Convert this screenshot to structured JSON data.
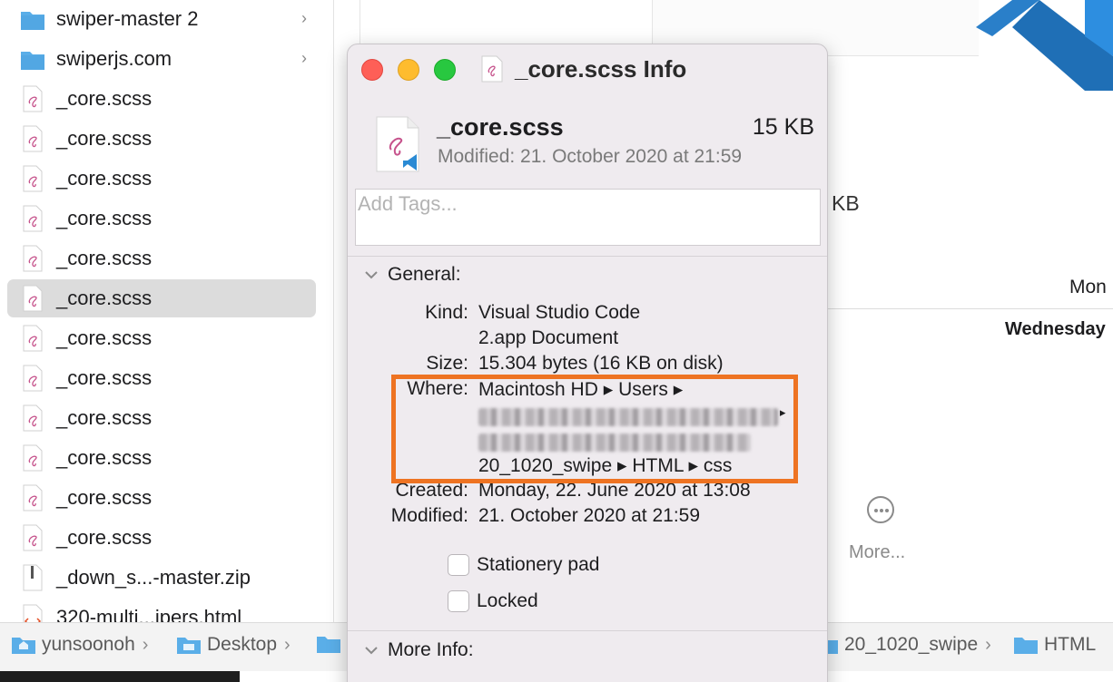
{
  "finder_list": {
    "items": [
      {
        "label": "swiper-master 2",
        "type": "folder",
        "has_chevron": true
      },
      {
        "label": "swiperjs.com",
        "type": "folder",
        "has_chevron": true
      },
      {
        "label": "_core.scss",
        "type": "scss"
      },
      {
        "label": "_core.scss",
        "type": "scss"
      },
      {
        "label": "_core.scss",
        "type": "scss"
      },
      {
        "label": "_core.scss",
        "type": "scss"
      },
      {
        "label": "_core.scss",
        "type": "scss"
      },
      {
        "label": "_core.scss",
        "type": "scss",
        "selected": true
      },
      {
        "label": "_core.scss",
        "type": "scss"
      },
      {
        "label": "_core.scss",
        "type": "scss"
      },
      {
        "label": "_core.scss",
        "type": "scss"
      },
      {
        "label": "_core.scss",
        "type": "scss"
      },
      {
        "label": "_core.scss",
        "type": "scss"
      },
      {
        "label": "_core.scss",
        "type": "scss"
      },
      {
        "label": "_down_s...-master.zip",
        "type": "zip"
      },
      {
        "label": "320-multi...ipers.html",
        "type": "html"
      }
    ]
  },
  "background_window": {
    "size_fragment": "KB",
    "day_header": "Mon",
    "day_value": "Wednesday",
    "more_label": "More..."
  },
  "path_bar": {
    "left": [
      {
        "label": "yunsoonoh",
        "icon": "home-folder-icon"
      },
      {
        "label": "Desktop",
        "icon": "desktop-folder-icon"
      }
    ],
    "right": [
      {
        "label": "20_1020_swipe",
        "icon": "folder-icon"
      },
      {
        "label": "HTML",
        "icon": "folder-icon"
      }
    ],
    "separator": "›"
  },
  "info_window": {
    "title": "_core.scss Info",
    "file_name": "_core.scss",
    "file_size": "15 KB",
    "modified_summary": "Modified: 21. October 2020 at 21:59",
    "tags_placeholder": "Add Tags...",
    "general": {
      "heading": "General:",
      "kind_label": "Kind:",
      "kind_value_1": "Visual Studio Code",
      "kind_value_2": "2.app Document",
      "size_label": "Size:",
      "size_value": "15.304 bytes (16 KB on disk)",
      "where_label": "Where:",
      "where_line_1": "Macintosh HD ▸ Users ▸",
      "where_line_4": "20_1020_swipe ▸ HTML ▸ css",
      "created_label": "Created:",
      "created_value": "Monday, 22. June 2020 at 13:08",
      "modified_label": "Modified:",
      "modified_value": "21. October 2020 at 21:59",
      "stationery_label": "Stationery pad",
      "locked_label": "Locked"
    },
    "more_info_heading": "More Info:"
  },
  "colors": {
    "highlight_border": "#ee7322",
    "folder_blue": "#5aaee8",
    "scss_pink": "#c6538c",
    "vscode_blue": "#2a8ad4"
  }
}
